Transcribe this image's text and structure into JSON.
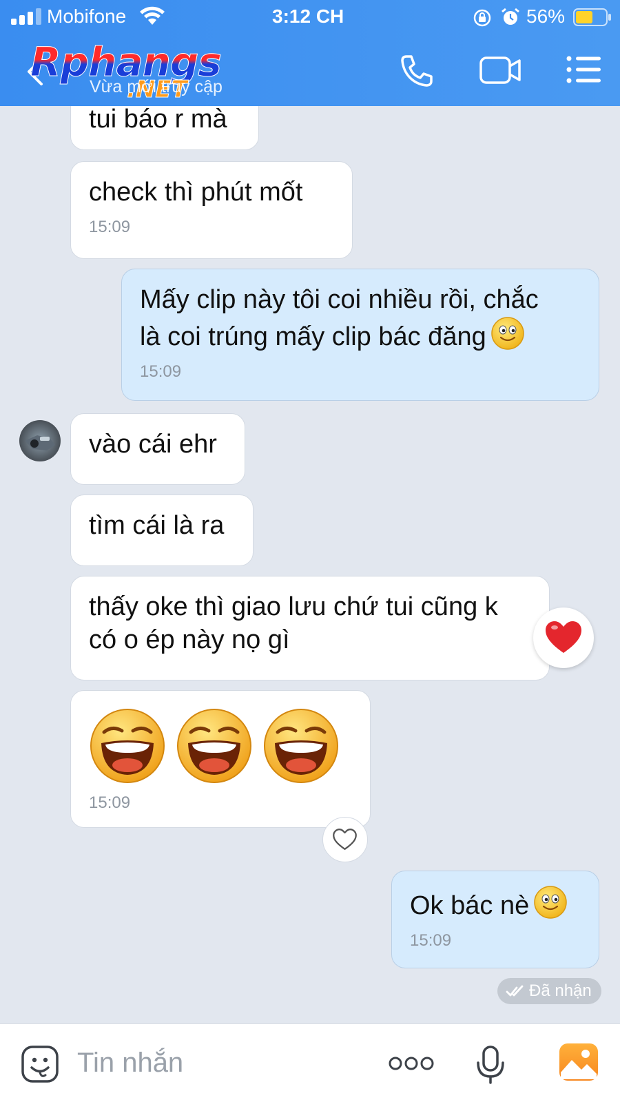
{
  "status_bar": {
    "carrier": "Mobifone",
    "time": "3:12 CH",
    "battery": "56%"
  },
  "header": {
    "logo_main": "Rphangs",
    "logo_suffix": ".NET",
    "subtitle": "Vừa mới truy cập",
    "icons": [
      "back-icon",
      "call-icon",
      "video-call-icon",
      "menu-icon"
    ]
  },
  "messages": [
    {
      "side": "them",
      "text": "tui báo r mà",
      "time": ""
    },
    {
      "side": "them",
      "text": "check thì phút mốt",
      "time": "15:09"
    },
    {
      "side": "me",
      "line1": "Mấy clip này tôi coi nhiều rồi, chắc",
      "line2": "là coi trúng mấy clip bác đăng",
      "time": "15:09"
    },
    {
      "side": "them",
      "text": "vào cái ehr",
      "time": ""
    },
    {
      "side": "them",
      "text": "tìm cái là ra",
      "time": ""
    },
    {
      "side": "them",
      "line1": "thấy oke thì giao lưu chứ tui cũng k",
      "line2": "có o ép này nọ gì",
      "time": ""
    },
    {
      "side": "them",
      "emoji_count": 3,
      "time": "15:09"
    },
    {
      "side": "me",
      "text": "Ok bác nè",
      "time": "15:09"
    }
  ],
  "delivery_status": "Đã nhận",
  "input": {
    "placeholder": "Tin nhắn"
  },
  "colors": {
    "header_blue": "#3a8df0",
    "chat_bg": "#e2e7ef",
    "my_bubble": "#d6ebfd",
    "their_bubble": "#ffffff",
    "reaction_red": "#e4262d",
    "photo_orange": "#f7931e"
  }
}
